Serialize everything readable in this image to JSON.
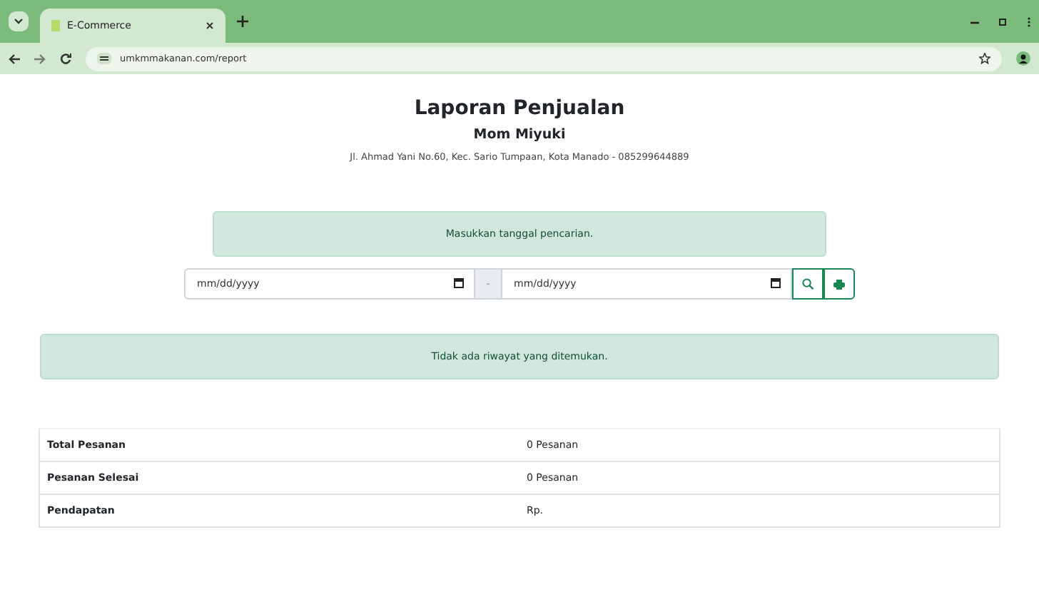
{
  "browser": {
    "tabs": [
      {
        "label": "E-Commerce",
        "selected": true
      }
    ],
    "address": "umkmmakanan.com/report"
  },
  "header": {
    "title": "Laporan Penjualan",
    "store": "Mom Miyuki",
    "address": "Jl. Ahmad Yani No.60, Kec. Sario Tumpaan, Kota Manado - 085299644889"
  },
  "search_hint": "Masukkan tanggal pencarian.",
  "date_range": {
    "start_placeholder": "mm/dd/yyyy",
    "separator": "-",
    "end_placeholder": "mm/dd/yyyy"
  },
  "empty_message": "Tidak ada riwayat yang ditemukan.",
  "summary": [
    {
      "label": "Total Pesanan",
      "value": "0 Pesanan"
    },
    {
      "label": "Pesanan Selesai",
      "value": "0 Pesanan"
    },
    {
      "label": "Pendapatan",
      "value": "Rp."
    }
  ]
}
